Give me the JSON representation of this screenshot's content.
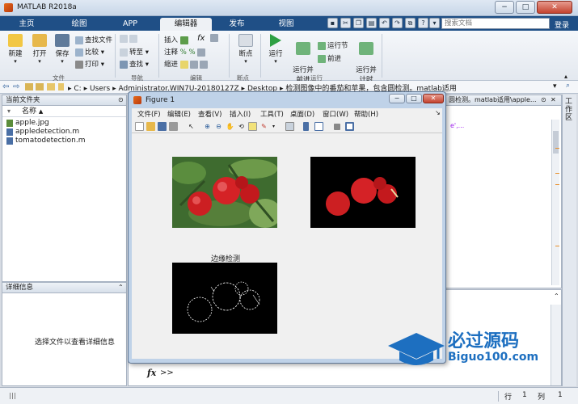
{
  "window": {
    "title": "MATLAB R2018a",
    "controls": [
      "−",
      "□",
      "✕"
    ]
  },
  "tabs": [
    "主页",
    "绘图",
    "APP",
    "编辑器",
    "发布",
    "视图"
  ],
  "active_tab": "编辑器",
  "search_placeholder": "搜索文档",
  "login_label": "登录",
  "ribbon": {
    "file": {
      "new": "新建",
      "open": "打开",
      "save": "保存",
      "find_files": "查找文件",
      "compare": "比较",
      "print": "打印",
      "group": "文件"
    },
    "navigate": {
      "goto": "转至",
      "find": "查找",
      "group": "导航"
    },
    "edit": {
      "insert": "插入",
      "comment": "注释",
      "indent": "缩进",
      "group": "编辑"
    },
    "breakpoints": {
      "label": "断点",
      "group": "断点"
    },
    "run": {
      "run": "运行",
      "run_advance": "运行并\n前进",
      "run_section": "运行节",
      "advance": "前进",
      "run_time": "运行并\n计时",
      "group": "运行"
    }
  },
  "address": {
    "segments": [
      "C:",
      "Users",
      "Administrator.WIN7U-20180127Z",
      "Desktop",
      "检测图像中的番茄和苹果，包含圆检测。matlab适用"
    ]
  },
  "current_folder": {
    "title": "当前文件夹",
    "column": "名称",
    "files": [
      "apple.jpg",
      "appledetection.m",
      "tomatodetection.m"
    ]
  },
  "details": {
    "title": "详细信息",
    "hint": "选择文件以查看详细信息"
  },
  "editor_snippet": "圆检测。matlab适用\\apple...",
  "editor_code_fragment": "e',...",
  "workspace_label": "工作区",
  "figure": {
    "title": "Figure 1",
    "menus": [
      "文件(F)",
      "编辑(E)",
      "查看(V)",
      "插入(I)",
      "工具(T)",
      "桌面(D)",
      "窗口(W)",
      "帮助(H)"
    ],
    "subplot_title": "边缘检测"
  },
  "command": {
    "prompt_symbol": "fx",
    "prompt": ">>"
  },
  "status": {
    "row_label": "行",
    "row": "1",
    "col_label": "列",
    "col": "1"
  },
  "watermark": {
    "name": "必过源码",
    "url": "Biguo100.com"
  },
  "colors": {
    "ribbon_tab_bg": "#1f4f86",
    "accent_run": "#2ea043",
    "watermark_blue": "#1d6fc0"
  }
}
